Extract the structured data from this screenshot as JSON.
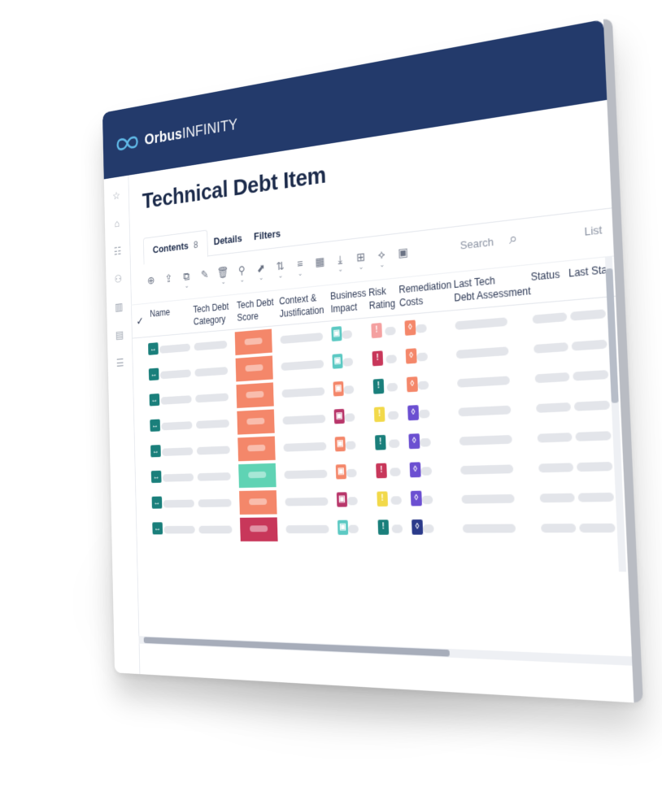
{
  "app": {
    "logo_bold": "Orbus",
    "logo_thin": "INFINITY",
    "page_title": "Technical Debt Item"
  },
  "sidebar": {
    "items": [
      {
        "icon": "star-icon",
        "glyph": "☆"
      },
      {
        "icon": "home-icon",
        "glyph": "⌂"
      },
      {
        "icon": "server-icon",
        "glyph": "☷"
      },
      {
        "icon": "users-icon",
        "glyph": "⚇"
      },
      {
        "icon": "library-icon",
        "glyph": "▥"
      },
      {
        "icon": "document-icon",
        "glyph": "▤"
      },
      {
        "icon": "checklist-icon",
        "glyph": "☰"
      }
    ]
  },
  "tabs": [
    {
      "label": "Contents",
      "count": "8",
      "active": true
    },
    {
      "label": "Details",
      "count": "",
      "active": false
    },
    {
      "label": "Filters",
      "count": "",
      "active": false
    }
  ],
  "toolbar": {
    "tools": [
      {
        "name": "add-icon",
        "glyph": "⊕",
        "caret": false
      },
      {
        "name": "export-icon",
        "glyph": "⇪",
        "caret": false
      },
      {
        "name": "open-icon",
        "glyph": "⧉",
        "caret": true
      },
      {
        "name": "edit-icon",
        "glyph": "✎",
        "caret": false
      },
      {
        "name": "delete-icon",
        "glyph": "🗑",
        "caret": true
      },
      {
        "name": "hierarchy-icon",
        "glyph": "⚲",
        "caret": true
      },
      {
        "name": "navigate-icon",
        "glyph": "⬈",
        "caret": true
      },
      {
        "name": "sort-icon",
        "glyph": "⇅",
        "caret": true
      },
      {
        "name": "group-icon",
        "glyph": "≡",
        "caret": true
      },
      {
        "name": "columns-icon",
        "glyph": "▦",
        "caret": false
      },
      {
        "name": "download-icon",
        "glyph": "⤓",
        "caret": true
      },
      {
        "name": "compare-icon",
        "glyph": "⊞",
        "caret": true
      },
      {
        "name": "relation-icon",
        "glyph": "⟡",
        "caret": true
      },
      {
        "name": "image-icon",
        "glyph": "▣",
        "caret": false
      }
    ],
    "search_label": "Search",
    "list_label": "List"
  },
  "columns": [
    "Name",
    "Tech Debt\nCategory",
    "Tech Debt\nScore",
    "Context &\nJustification",
    "Business\nImpact",
    "Risk\nRating",
    "Remediation\nCosts",
    "Last Tech\nDebt Assessment",
    "Status",
    "Last Sta"
  ],
  "colors": {
    "header_bg": "#233a6b",
    "teal": "#1a7f7b",
    "salmon": "#f4876a",
    "mint": "#5fd3b4",
    "crimson": "#c8375a",
    "bi_teal": "#5cc9c3",
    "bi_orange": "#f4876a",
    "bi_magenta": "#b8366a",
    "rr_pink": "#f4a0a0",
    "rr_crimson": "#c8375a",
    "rr_teal": "#1a7f7b",
    "rr_yellow": "#f2d94a",
    "rc_orange": "#f4876a",
    "rc_purple": "#6b4fd1",
    "rc_navy": "#2b3a8a"
  },
  "rows": [
    {
      "score": "salmon",
      "bi": "bi_teal",
      "rr": "rr_pink",
      "rc": "rc_orange"
    },
    {
      "score": "salmon",
      "bi": "bi_teal",
      "rr": "rr_crimson",
      "rc": "rc_orange"
    },
    {
      "score": "salmon",
      "bi": "bi_orange",
      "rr": "rr_teal",
      "rc": "rc_orange"
    },
    {
      "score": "salmon",
      "bi": "bi_magenta",
      "rr": "rr_yellow",
      "rc": "rc_purple"
    },
    {
      "score": "salmon",
      "bi": "bi_orange",
      "rr": "rr_teal",
      "rc": "rc_purple"
    },
    {
      "score": "mint",
      "bi": "bi_orange",
      "rr": "rr_crimson",
      "rc": "rc_purple"
    },
    {
      "score": "salmon",
      "bi": "bi_magenta",
      "rr": "rr_yellow",
      "rc": "rc_purple"
    },
    {
      "score": "crimson",
      "bi": "bi_teal",
      "rr": "rr_teal",
      "rc": "rc_navy"
    }
  ]
}
